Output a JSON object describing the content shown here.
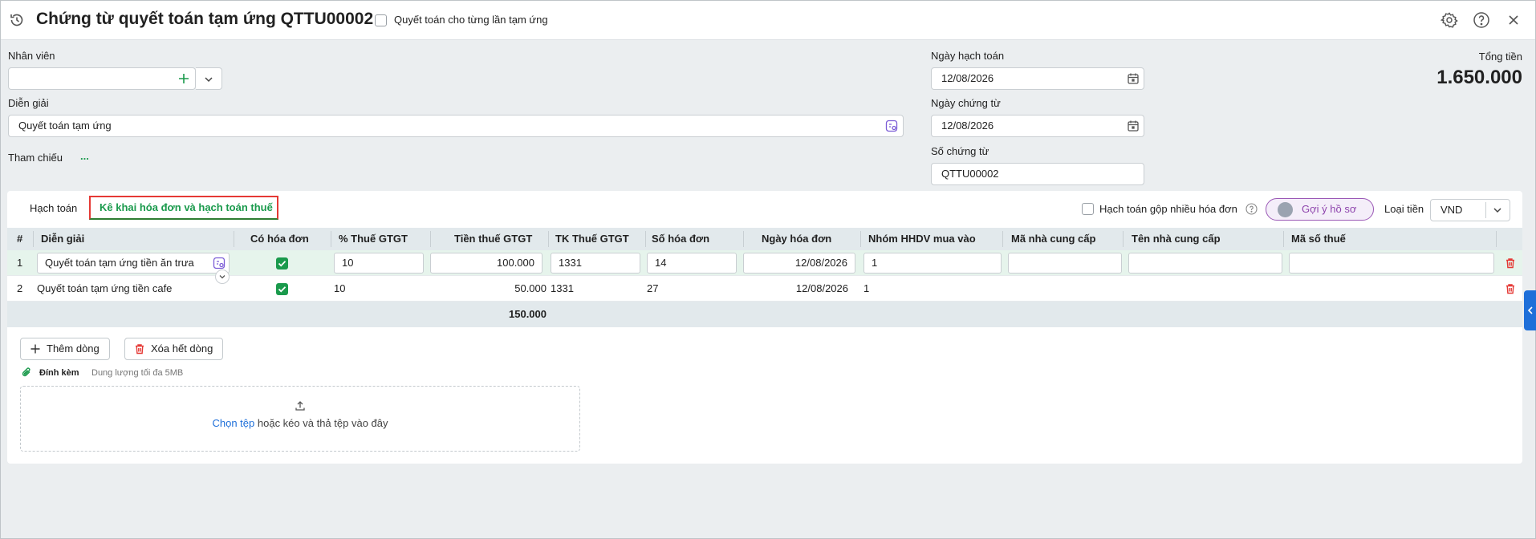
{
  "header": {
    "title": "Chứng từ quyết toán tạm ứng QTTU00002",
    "per_advance_label": "Quyết toán cho từng lần tạm ứng"
  },
  "form": {
    "employee_label": "Nhân viên",
    "employee_value": "",
    "description_label": "Diễn giải",
    "description_value": "Quyết toán tạm ứng",
    "reference_label": "Tham chiếu",
    "reference_value": "...",
    "posting_date_label": "Ngày hạch toán",
    "posting_date_value": "12/08/2026",
    "voucher_date_label": "Ngày chứng từ",
    "voucher_date_value": "12/08/2026",
    "voucher_no_label": "Số chứng từ",
    "voucher_no_value": "QTTU00002",
    "total_label": "Tổng tiền",
    "total_value": "1.650.000"
  },
  "tabs": {
    "accounting": "Hạch toán",
    "invoice_tax": "Kê khai hóa đơn và hạch toán thuế"
  },
  "toolbar": {
    "merge_invoices_label": "Hạch toán gộp nhiều hóa đơn",
    "suggest_button": "Gợi ý hồ sơ",
    "currency_label": "Loại tiền",
    "currency_value": "VND"
  },
  "table": {
    "headers": {
      "no": "#",
      "description": "Diễn giải",
      "has_invoice": "Có hóa đơn",
      "vat_rate": "% Thuế GTGT",
      "vat_amount": "Tiền thuế GTGT",
      "vat_account": "TK Thuế GTGT",
      "invoice_no": "Số hóa đơn",
      "invoice_date": "Ngày hóa đơn",
      "goods_group": "Nhóm HHDV mua vào",
      "supplier_code": "Mã nhà cung cấp",
      "supplier_name": "Tên nhà cung cấp",
      "tax_code": "Mã số thuế"
    },
    "rows": [
      {
        "no": "1",
        "description": "Quyết toán tạm ứng tiền ăn trưa",
        "has_invoice": true,
        "vat_rate": "10",
        "vat_amount": "100.000",
        "vat_account": "1331",
        "invoice_no": "14",
        "invoice_date": "12/08/2026",
        "goods_group": "1",
        "supplier_code": "",
        "supplier_name": "",
        "tax_code": ""
      },
      {
        "no": "2",
        "description": "Quyết toán tạm ứng tiền cafe",
        "has_invoice": true,
        "vat_rate": "10",
        "vat_amount": "50.000",
        "vat_account": "1331",
        "invoice_no": "27",
        "invoice_date": "12/08/2026",
        "goods_group": "1",
        "supplier_code": "",
        "supplier_name": "",
        "tax_code": ""
      }
    ],
    "total_vat": "150.000"
  },
  "actions": {
    "add_row": "Thêm dòng",
    "delete_all": "Xóa hết dòng"
  },
  "attachment": {
    "label": "Đính kèm",
    "hint": "Dung lượng tối đa 5MB",
    "choose_file": "Chọn tệp",
    "drop_text": "hoặc kéo và thả tệp vào đây"
  },
  "colors": {
    "accent_green": "#1a9a4c",
    "link_blue": "#1e6fd9",
    "delete_red": "#e53935",
    "suggest_purple": "#8e44ad"
  }
}
